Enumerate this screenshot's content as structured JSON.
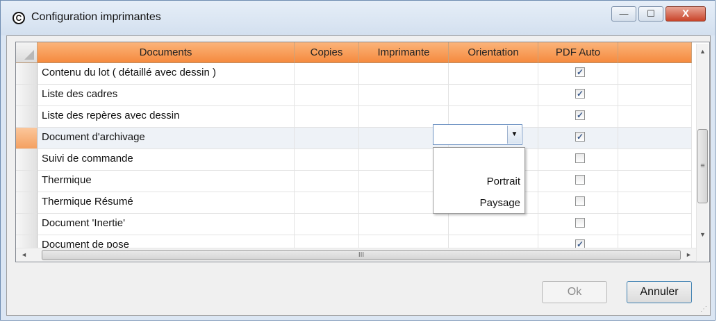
{
  "window": {
    "title": "Configuration imprimantes",
    "buttons": {
      "minimize": "—",
      "maximize": "☐",
      "close": "X"
    },
    "app_icon": "circled-c-icon"
  },
  "grid": {
    "columns": [
      "Documents",
      "Copies",
      "Imprimante",
      "Orientation",
      "PDF Auto"
    ],
    "rows": [
      {
        "document": "Contenu du lot ( détaillé avec dessin )",
        "pdf_auto": true
      },
      {
        "document": "Liste des cadres",
        "pdf_auto": true
      },
      {
        "document": "Liste des repères avec dessin",
        "pdf_auto": true
      },
      {
        "document": "Document d'archivage",
        "pdf_auto": true,
        "selected": true
      },
      {
        "document": "Suivi de commande",
        "pdf_auto": false
      },
      {
        "document": "Thermique",
        "pdf_auto": false
      },
      {
        "document": "Thermique Résumé",
        "pdf_auto": false
      },
      {
        "document": "Document 'Inertie'",
        "pdf_auto": false
      },
      {
        "document": "Document de pose",
        "pdf_auto": true
      }
    ],
    "orientation_dropdown": {
      "value": "",
      "options": [
        "",
        "Portrait",
        "Paysage"
      ]
    },
    "vscroll": {
      "up": "▲",
      "down": "▼",
      "thumb_grip": "≡"
    },
    "hscroll": {
      "left": "◄",
      "right": "►",
      "thumb_grip": "III"
    }
  },
  "footer": {
    "ok_label": "Ok",
    "ok_enabled": false,
    "cancel_label": "Annuler"
  },
  "colors": {
    "header": "#f79a52",
    "selected_row_header": "#f7b27a",
    "window_frame": "#dbe6f3"
  }
}
